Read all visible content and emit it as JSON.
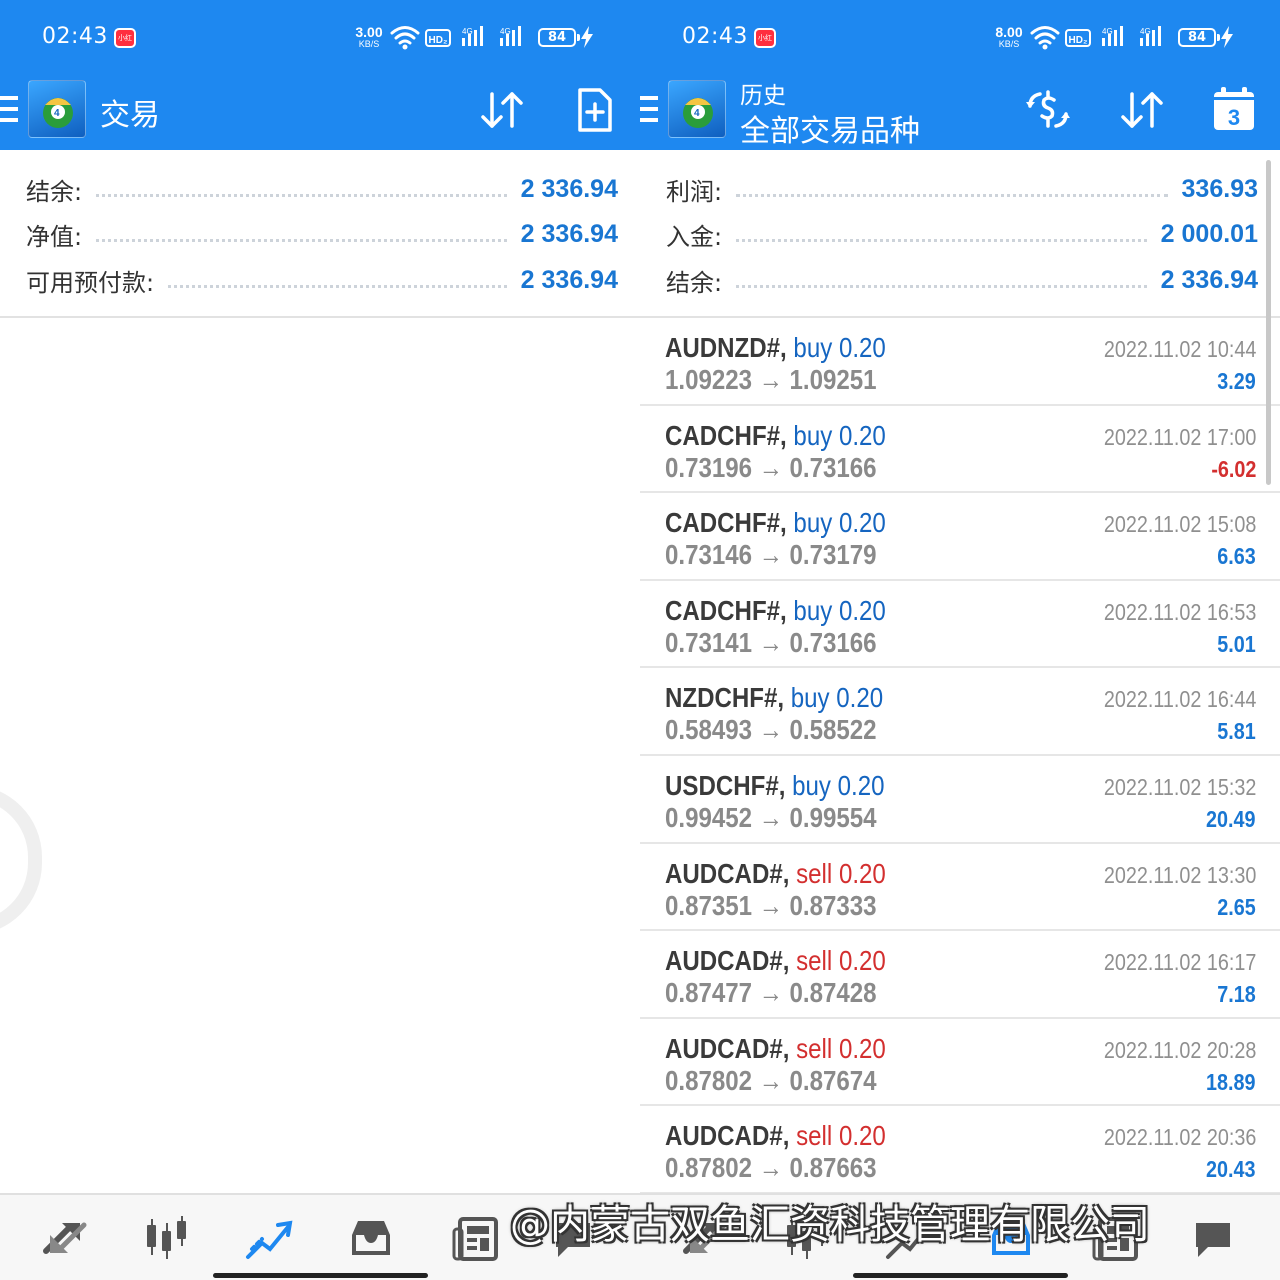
{
  "colors": {
    "header": "#1e88f0",
    "value_blue": "#1976d2",
    "buy": "#1565c0",
    "sell": "#d32f2f",
    "negative": "#d32f2f"
  },
  "left": {
    "status": {
      "time": "02:43",
      "speed_num": "3.00",
      "speed_unit": "KB/S",
      "battery": "84",
      "notif_badge": "小红书"
    },
    "appbar": {
      "title": "交易",
      "icons": [
        "menu-icon",
        "app-logo",
        "sort-icon",
        "new-order-icon"
      ]
    },
    "summary": [
      {
        "label": "结余:",
        "value": "2 336.94"
      },
      {
        "label": "净值:",
        "value": "2 336.94"
      },
      {
        "label": "可用预付款:",
        "value": "2 336.94"
      }
    ],
    "bottom_nav": [
      "quotes-icon",
      "charts-icon",
      "trade-icon",
      "history-icon",
      "news-icon",
      "chat-icon"
    ]
  },
  "right": {
    "status": {
      "time": "02:43",
      "speed_num": "8.00",
      "speed_unit": "KB/S",
      "battery": "84",
      "notif_badge": "小红书"
    },
    "appbar": {
      "title": "历史",
      "subtitle": "全部交易品种",
      "calendar_day": "3",
      "icons": [
        "menu-icon",
        "app-logo",
        "currency-filter-icon",
        "sort-icon",
        "calendar-icon"
      ]
    },
    "summary": [
      {
        "label": "利润:",
        "value": "336.93"
      },
      {
        "label": "入金:",
        "value": "2 000.01"
      },
      {
        "label": "结余:",
        "value": "2 336.94"
      }
    ],
    "deals": [
      {
        "symbol": "AUDNZD#,",
        "side": "buy",
        "volume": "0.20",
        "prices": "1.09223 → 1.09251",
        "time": "2022.11.02 10:44",
        "profit": "3.29",
        "negative": false
      },
      {
        "symbol": "CADCHF#,",
        "side": "buy",
        "volume": "0.20",
        "prices": "0.73196 → 0.73166",
        "time": "2022.11.02 17:00",
        "profit": "-6.02",
        "negative": true
      },
      {
        "symbol": "CADCHF#,",
        "side": "buy",
        "volume": "0.20",
        "prices": "0.73146 → 0.73179",
        "time": "2022.11.02 15:08",
        "profit": "6.63",
        "negative": false
      },
      {
        "symbol": "CADCHF#,",
        "side": "buy",
        "volume": "0.20",
        "prices": "0.73141 → 0.73166",
        "time": "2022.11.02 16:53",
        "profit": "5.01",
        "negative": false
      },
      {
        "symbol": "NZDCHF#,",
        "side": "buy",
        "volume": "0.20",
        "prices": "0.58493 → 0.58522",
        "time": "2022.11.02 16:44",
        "profit": "5.81",
        "negative": false
      },
      {
        "symbol": "USDCHF#,",
        "side": "buy",
        "volume": "0.20",
        "prices": "0.99452 → 0.99554",
        "time": "2022.11.02 15:32",
        "profit": "20.49",
        "negative": false
      },
      {
        "symbol": "AUDCAD#,",
        "side": "sell",
        "volume": "0.20",
        "prices": "0.87351 → 0.87333",
        "time": "2022.11.02 13:30",
        "profit": "2.65",
        "negative": false
      },
      {
        "symbol": "AUDCAD#,",
        "side": "sell",
        "volume": "0.20",
        "prices": "0.87477 → 0.87428",
        "time": "2022.11.02 16:17",
        "profit": "7.18",
        "negative": false
      },
      {
        "symbol": "AUDCAD#,",
        "side": "sell",
        "volume": "0.20",
        "prices": "0.87802 → 0.87674",
        "time": "2022.11.02 20:28",
        "profit": "18.89",
        "negative": false
      },
      {
        "symbol": "AUDCAD#,",
        "side": "sell",
        "volume": "0.20",
        "prices": "0.87802 → 0.87663",
        "time": "2022.11.02 20:36",
        "profit": "20.43",
        "negative": false
      }
    ],
    "bottom_nav": [
      "quotes-icon",
      "charts-icon",
      "trade-icon",
      "history-icon",
      "news-icon",
      "chat-icon"
    ]
  },
  "watermark": "@内蒙古双鱼汇资科技管理有限公司"
}
